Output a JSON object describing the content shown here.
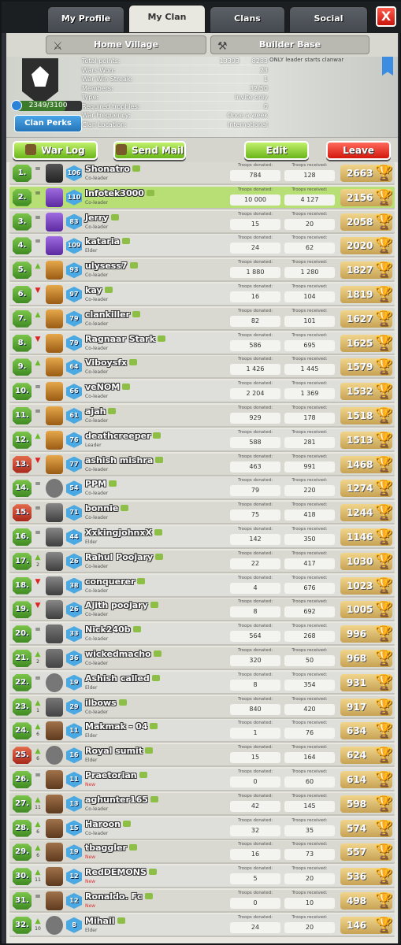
{
  "tabs": [
    "My Profile",
    "My Clan",
    "Clans",
    "Social"
  ],
  "close_label": "X",
  "subtabs": [
    "Home Village",
    "Builder Base"
  ],
  "info": {
    "progress": "2349/3100",
    "progress_fraction": 0.758,
    "perks": "Clan Perks",
    "note": "ONLY leader starts clanwar",
    "stats": [
      {
        "k": "Total points:",
        "v": "8283",
        "v2": "13393"
      },
      {
        "k": "Wars Won:",
        "v": "23"
      },
      {
        "k": "War Win Streak:",
        "v": "1"
      },
      {
        "k": "Members:",
        "v": "32/50"
      },
      {
        "k": "Type:",
        "v": "Invite only"
      },
      {
        "k": "Required trophies:",
        "v": "0"
      },
      {
        "k": "War Frequency:",
        "v": "Once a week"
      },
      {
        "k": "Clan Location:",
        "v": "International"
      }
    ]
  },
  "actions": {
    "war_log": "War Log",
    "send_mail": "Send Mail",
    "edit": "Edit",
    "leave": "Leave"
  },
  "donated_label": "Troops donated:",
  "received_label": "Troops received:",
  "members": [
    {
      "rank": "1.",
      "trend": "same",
      "delta": "",
      "league": "titan",
      "lvl": "106",
      "name": "Shonatro",
      "role": "Co-leader",
      "don": "784",
      "rec": "128",
      "trophies": "2663"
    },
    {
      "rank": "2.",
      "trend": "same",
      "delta": "",
      "league": "legend",
      "lvl": "110",
      "name": "Infotek3000",
      "role": "Co-leader",
      "don": "10 000",
      "rec": "4 127",
      "trophies": "2156"
    },
    {
      "rank": "3.",
      "trend": "same",
      "delta": "",
      "league": "legend",
      "lvl": "83",
      "name": "Jerry",
      "role": "Co-leader",
      "don": "15",
      "rec": "20",
      "trophies": "2058"
    },
    {
      "rank": "4.",
      "trend": "same",
      "delta": "",
      "league": "legend",
      "lvl": "109",
      "name": "kataria",
      "role": "Elder",
      "don": "24",
      "rec": "62",
      "trophies": "2020"
    },
    {
      "rank": "5.",
      "trend": "up",
      "delta": "",
      "league": "champ",
      "lvl": "93",
      "name": "ulysess7",
      "role": "Co-leader",
      "don": "1 880",
      "rec": "1 280",
      "trophies": "1827"
    },
    {
      "rank": "6.",
      "trend": "down",
      "delta": "",
      "league": "champ",
      "lvl": "97",
      "name": "kay",
      "role": "Co-leader",
      "don": "16",
      "rec": "104",
      "trophies": "1819"
    },
    {
      "rank": "7.",
      "trend": "up",
      "delta": "",
      "league": "champ",
      "lvl": "79",
      "name": "clankiller",
      "role": "Co-leader",
      "don": "82",
      "rec": "101",
      "trophies": "1627"
    },
    {
      "rank": "8.",
      "trend": "down",
      "delta": "",
      "league": "champ",
      "lvl": "79",
      "name": "Ragnaar Stark",
      "role": "Co-leader",
      "don": "586",
      "rec": "695",
      "trophies": "1625"
    },
    {
      "rank": "9.",
      "trend": "up",
      "delta": "",
      "league": "champ",
      "lvl": "64",
      "name": "Viboysfx",
      "role": "Co-leader",
      "don": "1 426",
      "rec": "1 445",
      "trophies": "1579"
    },
    {
      "rank": "10.",
      "trend": "same",
      "delta": "",
      "league": "champ",
      "lvl": "66",
      "name": "veNOM",
      "role": "Co-leader",
      "don": "2 204",
      "rec": "1 369",
      "trophies": "1532"
    },
    {
      "rank": "11.",
      "trend": "same",
      "delta": "",
      "league": "champ",
      "lvl": "61",
      "name": "ajah",
      "role": "Co-leader",
      "don": "929",
      "rec": "178",
      "trophies": "1518"
    },
    {
      "rank": "12.",
      "trend": "up",
      "delta": "",
      "league": "champ",
      "lvl": "76",
      "name": "deathcreeper",
      "role": "Leader",
      "don": "588",
      "rec": "281",
      "trophies": "1513"
    },
    {
      "rank": "13.",
      "trend": "down",
      "delta": "",
      "league": "champ",
      "lvl": "77",
      "name": "ashish mishra",
      "role": "Co-leader",
      "don": "463",
      "rec": "991",
      "trophies": "1468"
    },
    {
      "rank": "14.",
      "trend": "same",
      "delta": "",
      "league": "unranked",
      "lvl": "54",
      "name": "PPM",
      "role": "Co-leader",
      "don": "79",
      "rec": "220",
      "trophies": "1274"
    },
    {
      "rank": "15.",
      "trend": "same",
      "delta": "",
      "league": "master",
      "lvl": "71",
      "name": "bonnie",
      "role": "Co-leader",
      "don": "75",
      "rec": "418",
      "trophies": "1244"
    },
    {
      "rank": "16.",
      "trend": "same",
      "delta": "",
      "league": "master",
      "lvl": "44",
      "name": "XxkingjohnxX",
      "role": "Elder",
      "don": "142",
      "rec": "350",
      "trophies": "1146"
    },
    {
      "rank": "17.",
      "trend": "up",
      "delta": "2",
      "league": "master",
      "lvl": "26",
      "name": "Rahul Poojary",
      "role": "Co-leader",
      "don": "22",
      "rec": "417",
      "trophies": "1030"
    },
    {
      "rank": "18.",
      "trend": "down",
      "delta": "",
      "league": "master",
      "lvl": "38",
      "name": "conquerer",
      "role": "Co-leader",
      "don": "4",
      "rec": "676",
      "trophies": "1023"
    },
    {
      "rank": "19.",
      "trend": "down",
      "delta": "",
      "league": "master",
      "lvl": "26",
      "name": "Ajith poojary",
      "role": "Co-leader",
      "don": "8",
      "rec": "692",
      "trophies": "1005"
    },
    {
      "rank": "20.",
      "trend": "same",
      "delta": "",
      "league": "crystal",
      "lvl": "33",
      "name": "Nick240b",
      "role": "Co-leader",
      "don": "564",
      "rec": "268",
      "trophies": "996"
    },
    {
      "rank": "21.",
      "trend": "up",
      "delta": "2",
      "league": "crystal",
      "lvl": "36",
      "name": "wickedmacho",
      "role": "Co-leader",
      "don": "320",
      "rec": "50",
      "trophies": "968"
    },
    {
      "rank": "22.",
      "trend": "same",
      "delta": "",
      "league": "unranked",
      "lvl": "19",
      "name": "Ashish called",
      "role": "Elder",
      "don": "8",
      "rec": "354",
      "trophies": "931"
    },
    {
      "rank": "23.",
      "trend": "up",
      "delta": "1",
      "league": "crystal",
      "lvl": "29",
      "name": "ilbows",
      "role": "Co-leader",
      "don": "840",
      "rec": "420",
      "trophies": "917"
    },
    {
      "rank": "24.",
      "trend": "up",
      "delta": "6",
      "league": "gold",
      "lvl": "11",
      "name": "Makmak - 04",
      "role": "Elder",
      "don": "1",
      "rec": "76",
      "trophies": "634"
    },
    {
      "rank": "25.",
      "trend": "up",
      "delta": "6",
      "league": "unranked",
      "lvl": "16",
      "name": "Royal sumit",
      "role": "Elder",
      "don": "15",
      "rec": "164",
      "trophies": "624"
    },
    {
      "rank": "26.",
      "trend": "same",
      "delta": "",
      "league": "gold",
      "lvl": "11",
      "name": "Praetorian",
      "role": "New",
      "don": "0",
      "rec": "60",
      "trophies": "614"
    },
    {
      "rank": "27.",
      "trend": "up",
      "delta": "11",
      "league": "gold",
      "lvl": "13",
      "name": "aghunter165",
      "role": "Co-leader",
      "don": "42",
      "rec": "145",
      "trophies": "598"
    },
    {
      "rank": "28.",
      "trend": "up",
      "delta": "6",
      "league": "gold",
      "lvl": "15",
      "name": "Haroon",
      "role": "Co-leader",
      "don": "32",
      "rec": "35",
      "trophies": "574"
    },
    {
      "rank": "29.",
      "trend": "up",
      "delta": "6",
      "league": "gold",
      "lvl": "19",
      "name": "tbaggler",
      "role": "New",
      "don": "16",
      "rec": "73",
      "trophies": "557"
    },
    {
      "rank": "30.",
      "trend": "up",
      "delta": "11",
      "league": "gold",
      "lvl": "12",
      "name": "RedDEMONS",
      "role": "New",
      "don": "5",
      "rec": "20",
      "trophies": "536"
    },
    {
      "rank": "31.",
      "trend": "same",
      "delta": "",
      "league": "gold",
      "lvl": "12",
      "name": "Ronaldo. Fc",
      "role": "New",
      "don": "0",
      "rec": "10",
      "trophies": "498"
    },
    {
      "rank": "32.",
      "trend": "up",
      "delta": "10",
      "league": "unranked",
      "lvl": "8",
      "name": "Mihail",
      "role": "Elder",
      "don": "24",
      "rec": "20",
      "trophies": "146"
    }
  ],
  "red_ranks": [
    13,
    15,
    25
  ],
  "highlight_rank": 2,
  "colors": {
    "accent_green": "#6ab51a",
    "leave_red": "#d3170c",
    "highlight": "#b7df76"
  }
}
